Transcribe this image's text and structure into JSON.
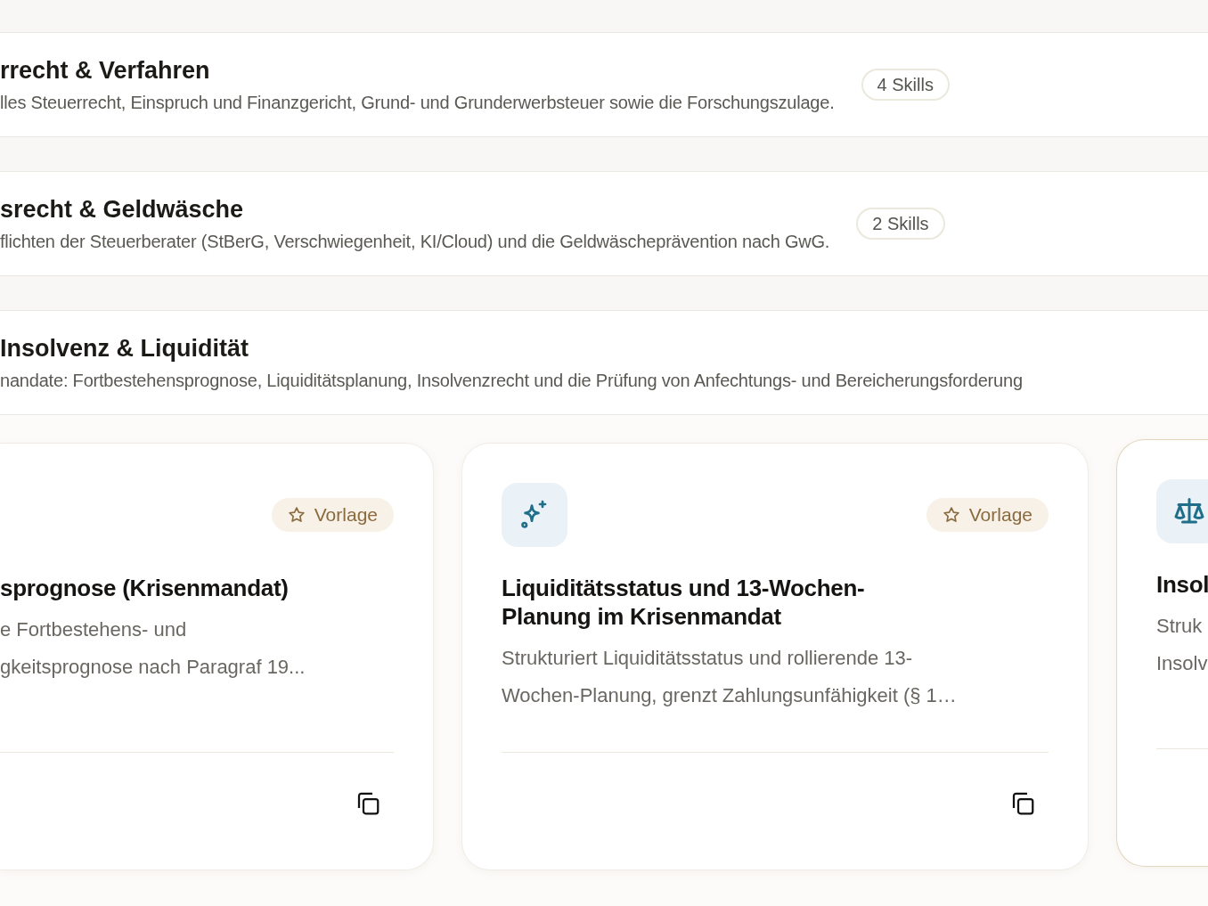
{
  "categories": [
    {
      "title": "rrecht & Verfahren",
      "description": "lles Steuerrecht, Einspruch und Finanzgericht, Grund- und Grunderwerbsteuer sowie die Forschungszulage.",
      "skills": "4 Skills"
    },
    {
      "title": "srecht & Geldwäsche",
      "description": "flichten der Steuerberater (StBerG, Verschwiegenheit, KI/Cloud) und die Geldwäscheprävention nach GwG.",
      "skills": "2 Skills"
    },
    {
      "title": "Insolvenz & Liquidität",
      "description": "nandate: Fortbestehensprognose, Liquiditätsplanung, Insolvenzrecht und die Prüfung von Anfechtungs- und Bereicherungsforderung"
    }
  ],
  "cards": [
    {
      "kind": "cut_left",
      "title": "sprognose (Krisenmandat)",
      "description": "e Fortbestehens- und\ngkeitsprognose nach Paragraf 19...",
      "badge": "Vorlage",
      "highlighted": false
    },
    {
      "kind": "full",
      "title": "Liquiditätsstatus und 13-Wochen-\nPlanung im Krisenmandat",
      "description": "Strukturiert Liquiditätsstatus und rollierende 13-\nWochen-Planung, grenzt Zahlungsunfähigkeit (§ 1…",
      "badge": "Vorlage",
      "highlighted": false
    },
    {
      "kind": "cut_right",
      "title": "Insol",
      "description": "Struk\nInsolv",
      "highlighted": true
    }
  ]
}
